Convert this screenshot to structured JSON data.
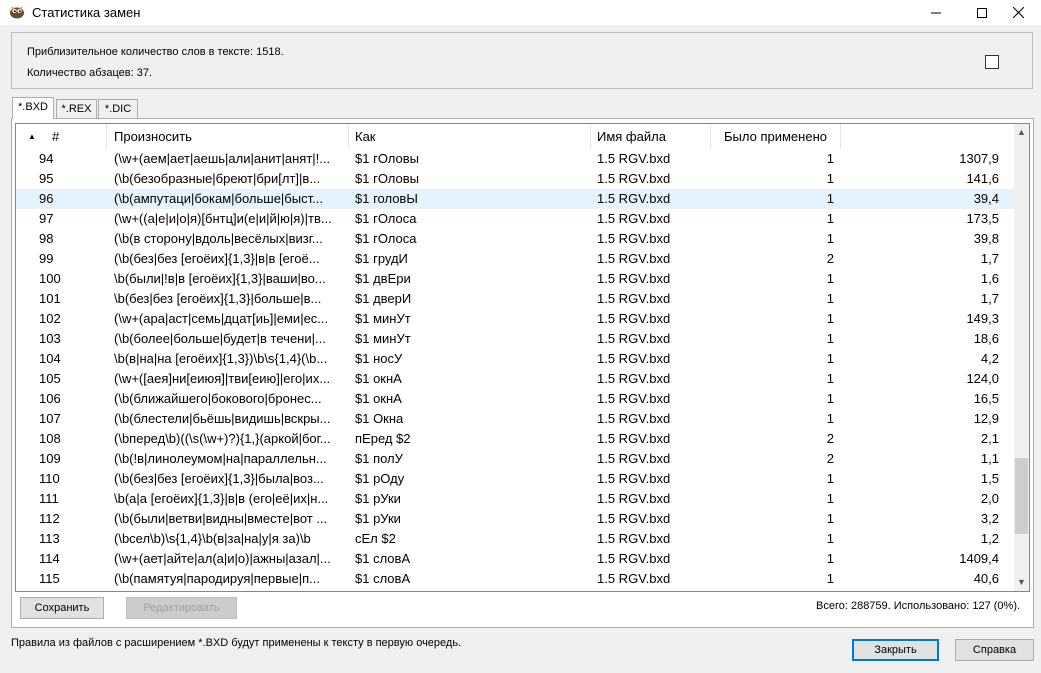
{
  "window": {
    "title": "Статистика замен",
    "icon": "app-icon",
    "controls": [
      "minimize-icon",
      "maximize-icon",
      "close-icon"
    ]
  },
  "info": {
    "words_line": "Приблизительное количество слов в тексте: 1518.",
    "paragraphs_line": "Количество абзацев: 37."
  },
  "tabs": [
    {
      "label": "*.BXD",
      "active": true
    },
    {
      "label": "*.REX",
      "active": false
    },
    {
      "label": "*.DIC",
      "active": false
    }
  ],
  "table": {
    "sort_icon": "sort-up-icon",
    "columns": [
      "#",
      "Произносить",
      "Как",
      "Имя файла",
      "Было применено",
      ""
    ],
    "selected_row": 2,
    "rows": [
      [
        "94",
        "(\\w+(аем|ает|аешь|али|анит|анят|!...",
        "$1 гОловы",
        "1.5 RGV.bxd",
        "1",
        "1307,9"
      ],
      [
        "95",
        "(\\b(безобразные|бреют|бри[лт]|в...",
        "$1 гОловы",
        "1.5 RGV.bxd",
        "1",
        "141,6"
      ],
      [
        "96",
        "(\\b(ампутаци|бокам|больше|быст...",
        "$1 головЫ",
        "1.5 RGV.bxd",
        "1",
        "39,4"
      ],
      [
        "97",
        "(\\w+((а|е|и|о|я)[бнтц]и(е|и|й|ю|я)|тв...",
        "$1 гОлоса",
        "1.5 RGV.bxd",
        "1",
        "173,5"
      ],
      [
        "98",
        "(\\b(в сторону|вдоль|весёлых|визг...",
        "$1 гОлоса",
        "1.5 RGV.bxd",
        "1",
        "39,8"
      ],
      [
        "99",
        "(\\b(без|без [егоёих]{1,3}|в|в [егоё...",
        "$1 грудИ",
        "1.5 RGV.bxd",
        "2",
        "1,7"
      ],
      [
        "100",
        "\\b(были|!в|в [егоёих]{1,3}|ваши|во...",
        "$1 двЕри",
        "1.5 RGV.bxd",
        "1",
        "1,6"
      ],
      [
        "101",
        "\\b(без|без [егоёих]{1,3}|больше|в...",
        "$1 дверИ",
        "1.5 RGV.bxd",
        "1",
        "1,7"
      ],
      [
        "102",
        "(\\w+(ара|аст|семь|дцат[иь]|еми|ес...",
        "$1 минУт",
        "1.5 RGV.bxd",
        "1",
        "149,3"
      ],
      [
        "103",
        "(\\b(более|больше|будет|в течени|...",
        "$1 минУт",
        "1.5 RGV.bxd",
        "1",
        "18,6"
      ],
      [
        "104",
        "\\b(в|на|на [егоёих]{1,3})\\b\\s{1,4}(\\b...",
        "$1 носУ",
        "1.5 RGV.bxd",
        "1",
        "4,2"
      ],
      [
        "105",
        "(\\w+([аея]ни[еиюя]|тви[еию]|его|их...",
        "$1 окнА",
        "1.5 RGV.bxd",
        "1",
        "124,0"
      ],
      [
        "106",
        "(\\b(ближайшего|бокового|бронес...",
        "$1 окнА",
        "1.5 RGV.bxd",
        "1",
        "16,5"
      ],
      [
        "107",
        "(\\b(блестели|бьёшь|видишь|вскры...",
        "$1 Окна",
        "1.5 RGV.bxd",
        "1",
        "12,9"
      ],
      [
        "108",
        "(\\bперед\\b)((\\s(\\w+)?){1,}(аркой|бог...",
        "пЕред $2",
        "1.5 RGV.bxd",
        "2",
        "2,1"
      ],
      [
        "109",
        "(\\b(!в|линолеумом|на|параллельн...",
        "$1 полУ",
        "1.5 RGV.bxd",
        "2",
        "1,1"
      ],
      [
        "110",
        "(\\b(без|без [егоёих]{1,3}|была|воз...",
        "$1 рОду",
        "1.5 RGV.bxd",
        "1",
        "1,5"
      ],
      [
        "111",
        "\\b(а|а [егоёих]{1,3}|в|в (его|её|их|н...",
        "$1 рУки",
        "1.5 RGV.bxd",
        "1",
        "2,0"
      ],
      [
        "112",
        "(\\b(были|ветви|видны|вместе|вот ...",
        "$1 рУки",
        "1.5 RGV.bxd",
        "1",
        "3,2"
      ],
      [
        "113",
        "(\\bсел\\b)\\s{1,4}\\b(в|за|на|у|я за)\\b",
        "сЕл $2",
        "1.5 RGV.bxd",
        "1",
        "1,2"
      ],
      [
        "114",
        "(\\w+(ает|айте|ал(а|и|о)|ажны|азал|...",
        "$1 словА",
        "1.5 RGV.bxd",
        "1",
        "1409,4"
      ],
      [
        "115",
        "(\\b(памятуя|пародируя|первые|п...",
        "$1 словА",
        "1.5 RGV.bxd",
        "1",
        "40,6"
      ]
    ]
  },
  "buttons": {
    "save": "Сохранить",
    "edit": "Редактировать",
    "close": "Закрыть",
    "help": "Справка"
  },
  "totals": "Всего: 288759.   Использовано: 127  (0%).",
  "footer": "Правила из файлов с расширением *.BXD будут применены к тексту в первую очередь.",
  "scrollbar": {
    "up_icon": "scroll-up-icon",
    "down_icon": "scroll-down-icon"
  }
}
